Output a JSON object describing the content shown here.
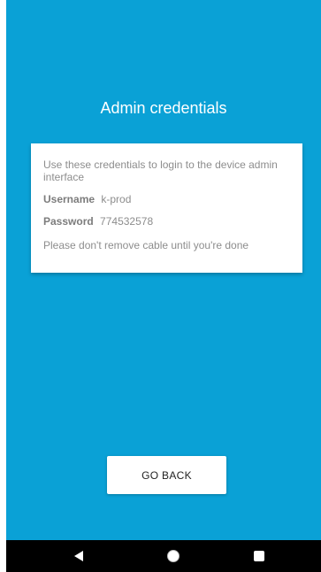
{
  "screen": {
    "title": "Admin credentials",
    "background_color": "#0aa1d6"
  },
  "card": {
    "intro": "Use these credentials to login to the device admin interface",
    "username_label": "Username",
    "username_value": "k-prod",
    "password_label": "Password",
    "password_value": "774532578",
    "note": "Please don't remove cable until you're done"
  },
  "actions": {
    "go_back_label": "GO BACK"
  },
  "navbar": {
    "icons": [
      "back-icon",
      "home-icon",
      "recent-apps-icon"
    ]
  }
}
